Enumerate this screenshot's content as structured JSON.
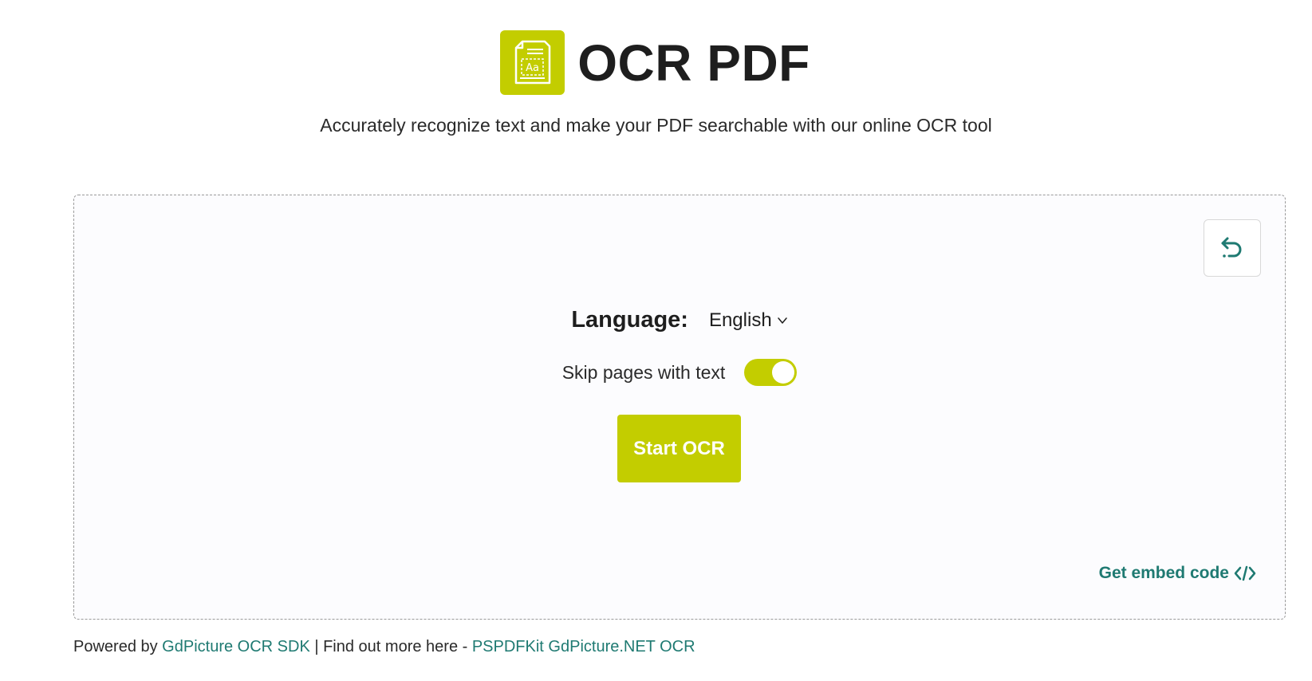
{
  "colors": {
    "brand": "#c3cd00",
    "link": "#1f7a72",
    "text": "#1e1e1e"
  },
  "header": {
    "logo_icon": "document-ocr-icon",
    "title": "OCR PDF",
    "subtitle": "Accurately recognize text and make your PDF searchable with our online OCR tool"
  },
  "tool": {
    "reset_icon": "undo-arrow-icon",
    "language": {
      "label": "Language:",
      "selected": "English",
      "icon": "chevron-down-icon"
    },
    "skip_pages": {
      "label": "Skip pages with text",
      "enabled": true
    },
    "start_button": "Start OCR",
    "embed": {
      "label": "Get embed code",
      "icon": "code-brackets-icon"
    }
  },
  "footer": {
    "prefix": "Powered by ",
    "sdk_link": "GdPicture OCR SDK",
    "middle": " | Find out more here - ",
    "net_link": "PSPDFKit GdPicture.NET OCR"
  }
}
